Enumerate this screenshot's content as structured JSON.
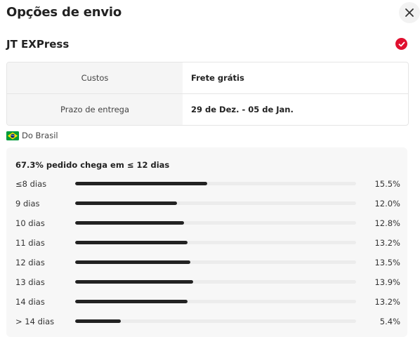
{
  "header": {
    "title": "Opções de envio"
  },
  "carrier": {
    "name": "JT EXPress",
    "selected": true
  },
  "info": [
    {
      "label": "Custos",
      "value": "Frete grátis"
    },
    {
      "label": "Prazo de entrega",
      "value": "29 de Dez. - 05 de Jan."
    }
  ],
  "origin": {
    "label": "Do Brasil"
  },
  "distribution": {
    "summary": "67.3% pedido chega em ≤ 12 dias",
    "rows": [
      {
        "label": "≤8 dias",
        "percent": "15.5%",
        "value": 15.5
      },
      {
        "label": "9 dias",
        "percent": "12.0%",
        "value": 12.0
      },
      {
        "label": "10 dias",
        "percent": "12.8%",
        "value": 12.8
      },
      {
        "label": "11 dias",
        "percent": "13.2%",
        "value": 13.2
      },
      {
        "label": "12 dias",
        "percent": "13.5%",
        "value": 13.5
      },
      {
        "label": "13 dias",
        "percent": "13.9%",
        "value": 13.9
      },
      {
        "label": "14 dias",
        "percent": "13.2%",
        "value": 13.2
      },
      {
        "label": "> 14 dias",
        "percent": "5.4%",
        "value": 5.4
      }
    ]
  },
  "colors": {
    "accent": "#e0102f",
    "bar": "#222222",
    "track": "#ececec"
  }
}
